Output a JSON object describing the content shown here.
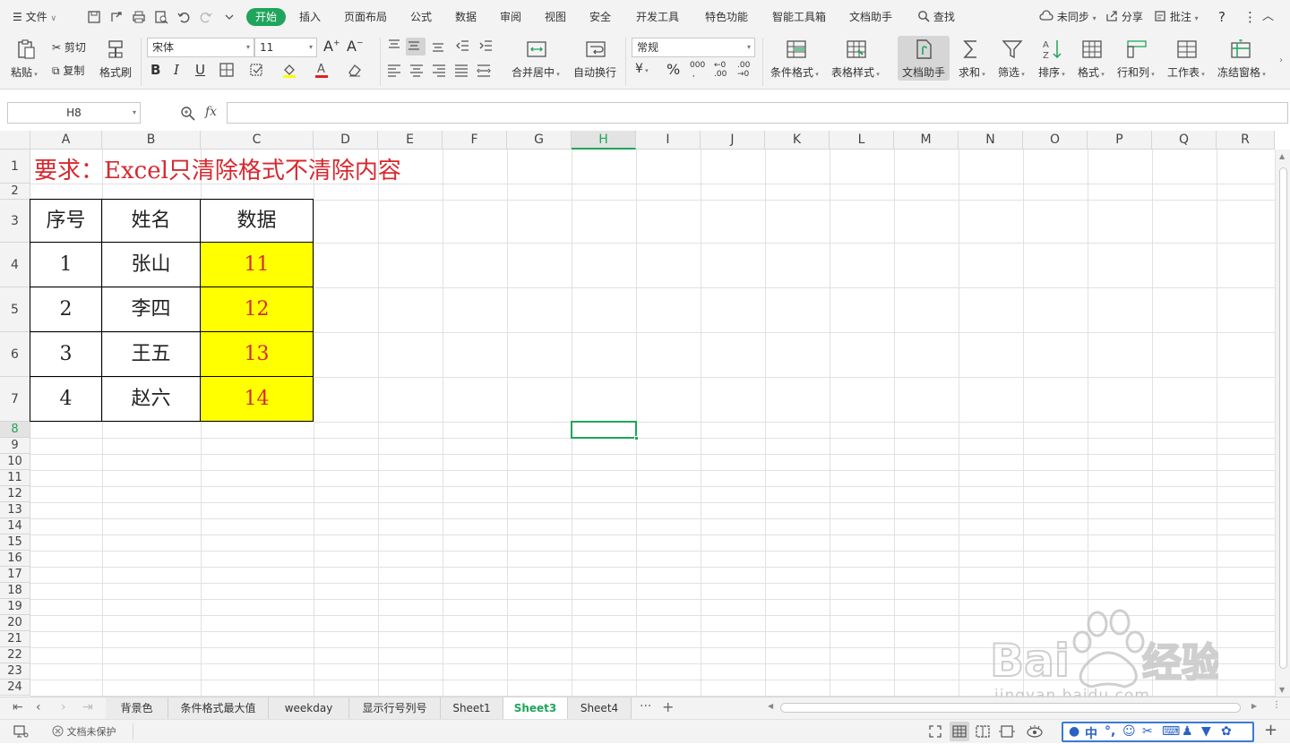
{
  "menubar": {
    "file_label": "文件",
    "tabs": [
      "开始",
      "插入",
      "页面布局",
      "公式",
      "数据",
      "审阅",
      "视图",
      "安全",
      "开发工具",
      "特色功能",
      "智能工具箱",
      "文档助手"
    ],
    "active_tab": "开始",
    "search_label": "查找",
    "sync_label": "未同步",
    "share_label": "分享",
    "comment_label": "批注",
    "help_label": "?"
  },
  "ribbon": {
    "paste": "粘贴",
    "cut": "剪切",
    "copy": "复制",
    "format_painter": "格式刷",
    "font_name": "宋体",
    "font_size": "11",
    "bold": "B",
    "italic": "I",
    "underline": "U",
    "merge_center": "合并居中",
    "wrap_text": "自动换行",
    "number_format": "常规",
    "percent": "%",
    "thousands": "000",
    "inc_decimal": ".00",
    "dec_decimal": ".00",
    "conditional_format": "条件格式",
    "table_style": "表格样式",
    "doc_assistant": "文档助手",
    "sum": "求和",
    "filter": "筛选",
    "sort": "排序",
    "format": "格式",
    "row_col": "行和列",
    "worksheet": "工作表",
    "freeze": "冻结窗格"
  },
  "formula_bar": {
    "name_box": "H8",
    "fx": "fx",
    "formula": ""
  },
  "grid": {
    "columns": [
      "A",
      "B",
      "C",
      "D",
      "E",
      "F",
      "G",
      "H",
      "I",
      "J",
      "K",
      "L",
      "M",
      "N",
      "O",
      "P",
      "Q",
      "R"
    ],
    "rows": [
      "1",
      "2",
      "3",
      "4",
      "5",
      "6",
      "7",
      "8",
      "9",
      "10",
      "11",
      "12",
      "13",
      "14",
      "15",
      "16",
      "17",
      "18",
      "19",
      "20",
      "21",
      "22",
      "23",
      "24"
    ],
    "selected_column": "H",
    "selected_row": "8",
    "title": "要求：Excel只清除格式不清除内容",
    "table": {
      "headers": [
        "序号",
        "姓名",
        "数据"
      ],
      "rows": [
        [
          "1",
          "张山",
          "11"
        ],
        [
          "2",
          "李四",
          "12"
        ],
        [
          "3",
          "王五",
          "13"
        ],
        [
          "4",
          "赵六",
          "14"
        ]
      ],
      "data_fill": "#ffff00",
      "data_color": "#d8282e"
    }
  },
  "sheets": {
    "tabs": [
      "背景色",
      "条件格式最大值",
      "weekday",
      "显示行号列号",
      "Sheet1",
      "Sheet3",
      "Sheet4"
    ],
    "active": "Sheet3",
    "more": "···",
    "add": "+"
  },
  "statusbar": {
    "protect_label": "文档未保护",
    "ime_mode": "中",
    "zoom_plus": "+"
  },
  "watermark": {
    "brand": "Bai du 经验",
    "url": "jingyan.baidu.com"
  },
  "colors": {
    "accent": "#1fa55c",
    "title_red": "#d8282e",
    "highlight_yellow": "#ffff00"
  }
}
